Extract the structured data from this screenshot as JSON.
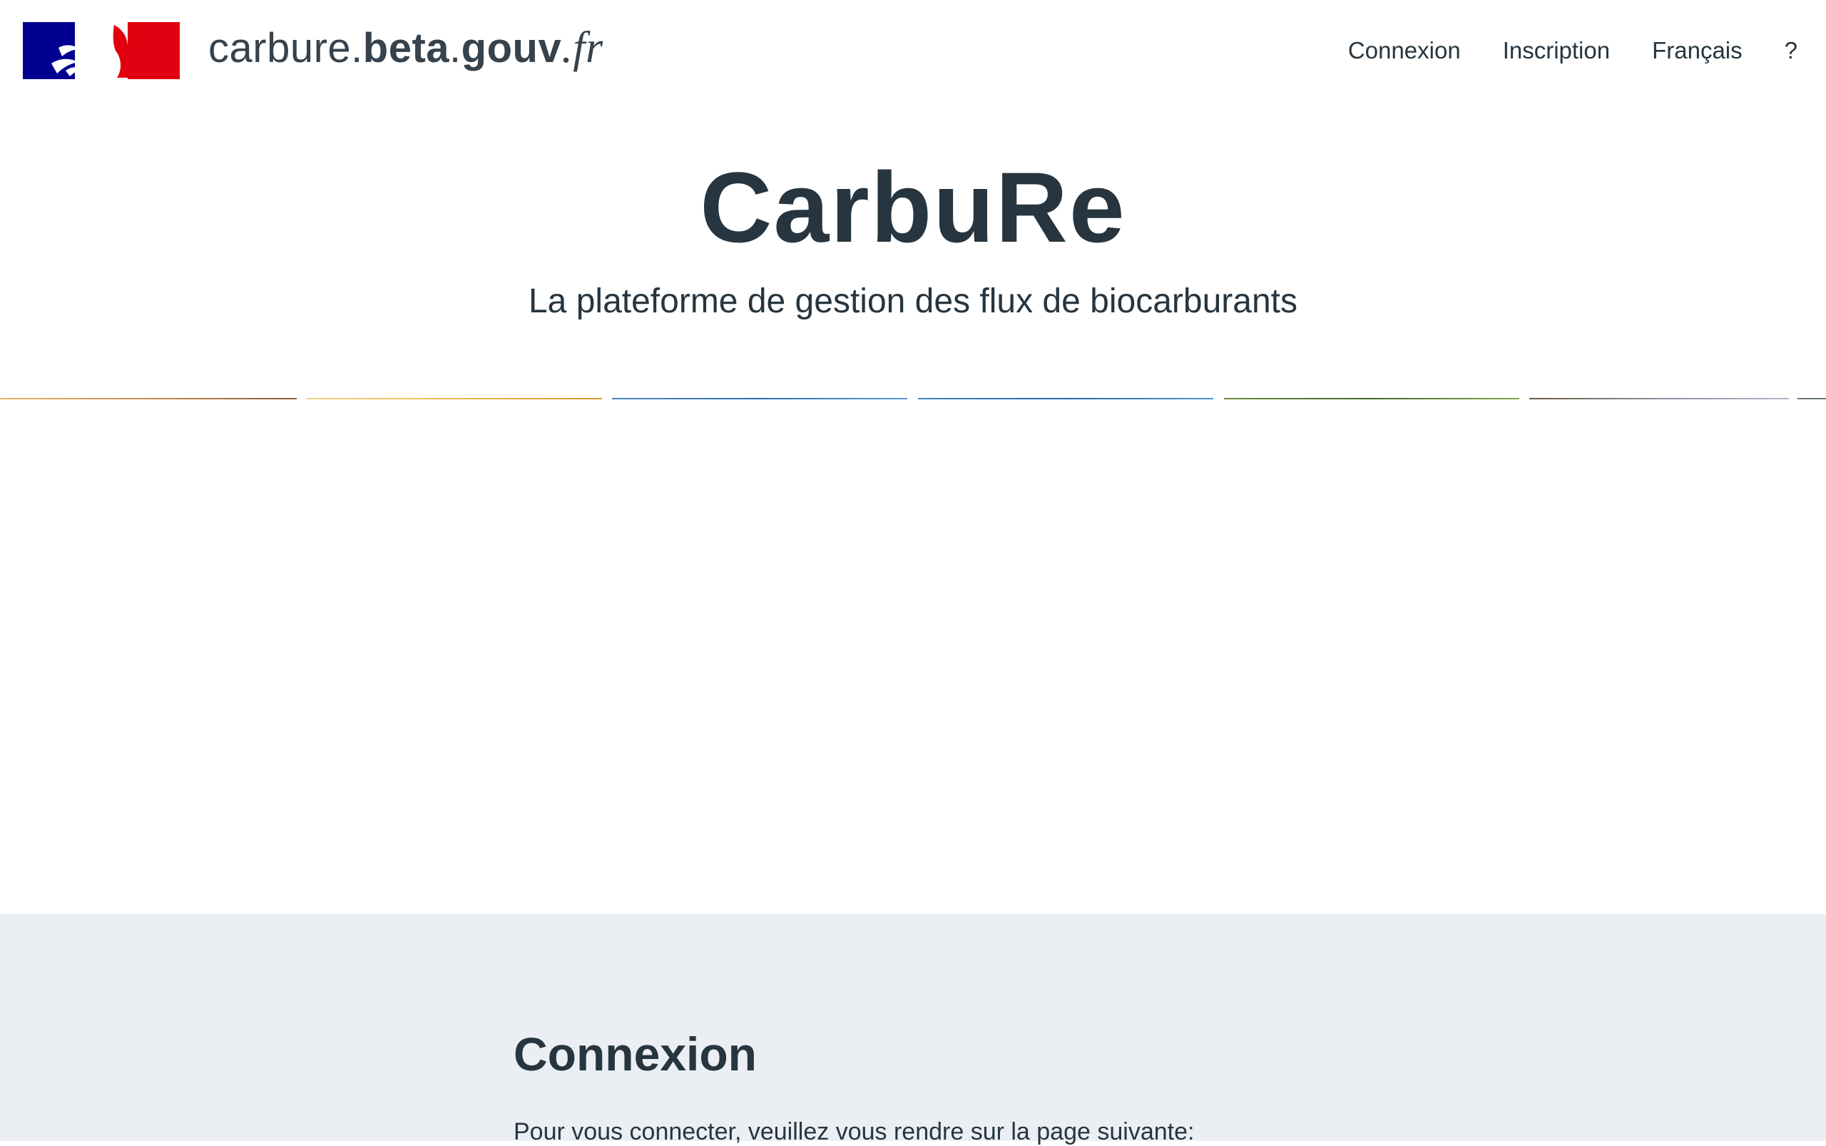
{
  "header": {
    "brand_part1": "carbure.",
    "brand_part2": "beta",
    "brand_part3": ".",
    "brand_part4": "gouv",
    "brand_part5": ".fr",
    "logo_icon": "marianne-logo-icon"
  },
  "nav": {
    "items": [
      {
        "label": "Connexion"
      },
      {
        "label": "Inscription"
      },
      {
        "label": "Français"
      },
      {
        "label": "?"
      }
    ]
  },
  "hero": {
    "title": "CarbuRe",
    "subtitle": "La plateforme de gestion des flux de biocarburants"
  },
  "login": {
    "title": "Connexion",
    "text": "Pour vous connecter, veuillez vous rendre sur la page suivante:"
  },
  "colors": {
    "text": "#26353f",
    "panel_bg": "#ebeff3",
    "flag_blue": "#000091",
    "flag_red": "#e1000f"
  }
}
